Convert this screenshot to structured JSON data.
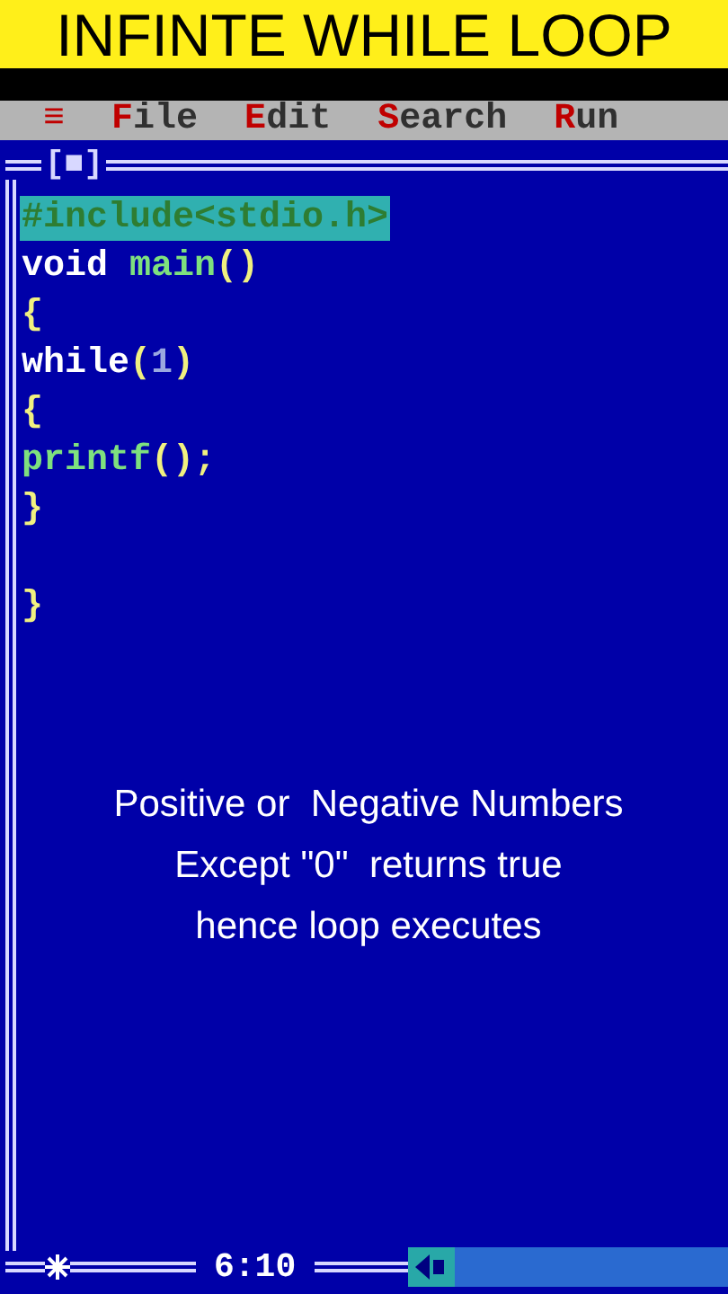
{
  "video_title": "INFINTE WHILE LOOP",
  "menu_bar": {
    "system_menu": "≡",
    "items": [
      {
        "label": "File"
      },
      {
        "label": "Edit"
      },
      {
        "label": "Search"
      },
      {
        "label": "Run"
      }
    ]
  },
  "editor": {
    "close_box": "[■]",
    "lines": [
      {
        "selected": true,
        "tokens": [
          {
            "text": "#include<stdio.h>",
            "kind": "directive"
          }
        ]
      },
      {
        "selected": false,
        "tokens": [
          {
            "text": "void ",
            "kind": "keyword"
          },
          {
            "text": "main",
            "kind": "function"
          },
          {
            "text": "()",
            "kind": "symbol"
          }
        ]
      },
      {
        "selected": false,
        "tokens": [
          {
            "text": "{",
            "kind": "symbol"
          }
        ]
      },
      {
        "selected": false,
        "tokens": [
          {
            "text": "while",
            "kind": "keyword"
          },
          {
            "text": "(",
            "kind": "symbol"
          },
          {
            "text": "1",
            "kind": "number"
          },
          {
            "text": ")",
            "kind": "symbol"
          }
        ]
      },
      {
        "selected": false,
        "tokens": [
          {
            "text": "{",
            "kind": "symbol"
          }
        ]
      },
      {
        "selected": false,
        "tokens": [
          {
            "text": "printf",
            "kind": "function"
          },
          {
            "text": "();",
            "kind": "symbol"
          }
        ]
      },
      {
        "selected": false,
        "tokens": [
          {
            "text": "}",
            "kind": "symbol"
          }
        ]
      },
      {
        "selected": false
      },
      {
        "selected": false,
        "tokens": [
          {
            "text": "}",
            "kind": "symbol"
          }
        ]
      }
    ],
    "caption": [
      "Positive or  Negative Numbers",
      "Except \"0\"  returns true",
      "hence loop executes"
    ],
    "cursor_position": "6:10"
  }
}
